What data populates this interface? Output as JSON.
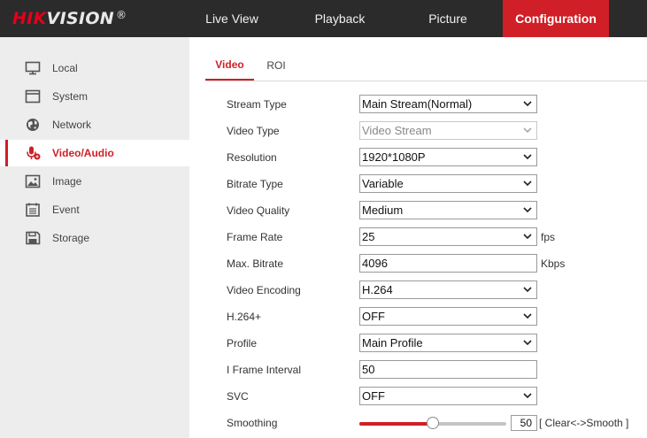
{
  "brand": {
    "logo_red": "HIK",
    "logo_white": "VISION",
    "logo_mark": "®"
  },
  "colors": {
    "accent": "#d01f27",
    "topbar": "#2b2b2b",
    "sidebar": "#ededed"
  },
  "nav": [
    {
      "label": "Live View",
      "active": false
    },
    {
      "label": "Playback",
      "active": false
    },
    {
      "label": "Picture",
      "active": false
    },
    {
      "label": "Configuration",
      "active": true
    }
  ],
  "sidebar": {
    "items": [
      {
        "label": "Local",
        "icon": "monitor-icon",
        "active": false
      },
      {
        "label": "System",
        "icon": "window-icon",
        "active": false
      },
      {
        "label": "Network",
        "icon": "globe-icon",
        "active": false
      },
      {
        "label": "Video/Audio",
        "icon": "microphone-icon",
        "active": true
      },
      {
        "label": "Image",
        "icon": "image-icon",
        "active": false
      },
      {
        "label": "Event",
        "icon": "calendar-icon",
        "active": false
      },
      {
        "label": "Storage",
        "icon": "floppy-icon",
        "active": false
      }
    ]
  },
  "tabs": [
    {
      "label": "Video",
      "active": true
    },
    {
      "label": "ROI",
      "active": false
    }
  ],
  "form": {
    "stream_type": {
      "label": "Stream Type",
      "value": "Main Stream(Normal)"
    },
    "video_type": {
      "label": "Video Type",
      "value": "Video Stream"
    },
    "resolution": {
      "label": "Resolution",
      "value": "1920*1080P"
    },
    "bitrate_type": {
      "label": "Bitrate Type",
      "value": "Variable"
    },
    "video_quality": {
      "label": "Video Quality",
      "value": "Medium"
    },
    "frame_rate": {
      "label": "Frame Rate",
      "value": "25",
      "unit": "fps"
    },
    "max_bitrate": {
      "label": "Max. Bitrate",
      "value": "4096",
      "unit": "Kbps"
    },
    "video_encoding": {
      "label": "Video Encoding",
      "value": "H.264"
    },
    "h264plus": {
      "label": "H.264+",
      "value": "OFF"
    },
    "profile": {
      "label": "Profile",
      "value": "Main Profile"
    },
    "i_frame_interval": {
      "label": "I Frame Interval",
      "value": "50"
    },
    "svc": {
      "label": "SVC",
      "value": "OFF"
    },
    "smoothing": {
      "label": "Smoothing",
      "value": "50",
      "level_percent": 50,
      "hint": "[ Clear<->Smooth ]"
    }
  }
}
